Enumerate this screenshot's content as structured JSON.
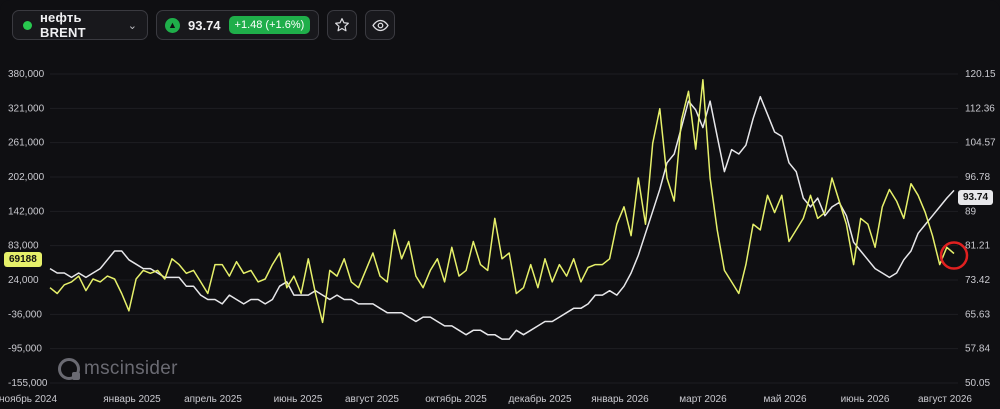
{
  "toolbar": {
    "ticker": "нефть BRENT",
    "status_color": "#28c84f",
    "price": "93.74",
    "change": "+1.48 (+1.6%)",
    "direction_icon": "triangle-up-icon",
    "favorite_icon": "star-icon",
    "watch_icon": "eye-icon",
    "dropdown_icon": "chevron-down-icon"
  },
  "watermark": {
    "text": "mscinsider",
    "logo_icon": "msc-logo-icon"
  },
  "chart_data": {
    "type": "line",
    "x_labels": [
      "ноябрь 2024",
      "январь 2025",
      "апрель 2025",
      "июнь 2025",
      "август 2025",
      "октябрь 2025",
      "декабрь 2025",
      "январь 2026",
      "март 2026",
      "май 2026",
      "июнь 2026",
      "август 2026"
    ],
    "left_axis": {
      "ticks": [
        "380,000",
        "321,000",
        "261,000",
        "202,000",
        "142,000",
        "83,000",
        "24,000",
        "-36,000",
        "-95,000",
        "-155,000"
      ],
      "range": [
        -155000,
        380000
      ],
      "current_value": "69188",
      "current_color": "#e6f06a"
    },
    "right_axis": {
      "ticks": [
        "120.15",
        "112.36",
        "104.57",
        "96.78",
        "89",
        "81.21",
        "73.42",
        "65.63",
        "57.84",
        "50.05"
      ],
      "range": [
        50.05,
        120.15
      ],
      "current_value": "93.74",
      "current_color": "#e7e7ea"
    },
    "series": [
      {
        "axis": "left",
        "color": "#e6f06a",
        "values": [
          10000,
          0,
          15000,
          20000,
          30000,
          5000,
          25000,
          20000,
          30000,
          25000,
          0,
          -30000,
          25000,
          40000,
          35000,
          40000,
          25000,
          60000,
          50000,
          35000,
          40000,
          20000,
          0,
          50000,
          50000,
          30000,
          55000,
          35000,
          40000,
          20000,
          25000,
          50000,
          70000,
          10000,
          30000,
          0,
          60000,
          0,
          -50000,
          40000,
          30000,
          60000,
          20000,
          10000,
          40000,
          70000,
          30000,
          20000,
          110000,
          60000,
          90000,
          30000,
          10000,
          40000,
          60000,
          20000,
          80000,
          30000,
          40000,
          90000,
          50000,
          40000,
          130000,
          60000,
          70000,
          0,
          10000,
          50000,
          10000,
          60000,
          20000,
          50000,
          30000,
          60000,
          20000,
          45000,
          50000,
          50000,
          60000,
          120000,
          150000,
          100000,
          200000,
          120000,
          260000,
          320000,
          200000,
          160000,
          300000,
          350000,
          250000,
          370000,
          200000,
          110000,
          40000,
          20000,
          0,
          50000,
          120000,
          110000,
          170000,
          140000,
          170000,
          90000,
          110000,
          130000,
          170000,
          130000,
          140000,
          200000,
          160000,
          120000,
          50000,
          130000,
          120000,
          80000,
          150000,
          180000,
          160000,
          130000,
          190000,
          170000,
          140000,
          100000,
          50000,
          80000,
          69188
        ]
      },
      {
        "axis": "right",
        "color": "#e7e7ea",
        "values": [
          76,
          75,
          75,
          74,
          75,
          74,
          75,
          76,
          78,
          80,
          80,
          78,
          77,
          76,
          76,
          75,
          74,
          74,
          74,
          72,
          72,
          70,
          69,
          69,
          68,
          70,
          69,
          68,
          69,
          69,
          68,
          69,
          72,
          73,
          70,
          70,
          70,
          71,
          70,
          69,
          70,
          69,
          69,
          68,
          68,
          68,
          67,
          66,
          66,
          66,
          65,
          64,
          65,
          65,
          64,
          63,
          63,
          62,
          61,
          62,
          62,
          61,
          61,
          60,
          60,
          62,
          61,
          62,
          63,
          64,
          64,
          65,
          66,
          67,
          67,
          68,
          70,
          70,
          71,
          70,
          72,
          75,
          79,
          84,
          89,
          94,
          100,
          102,
          108,
          114,
          112,
          108,
          114,
          106,
          98,
          103,
          102,
          104,
          110,
          115,
          111,
          107,
          106,
          100,
          98,
          92,
          90,
          92,
          88,
          90,
          91,
          88,
          82,
          80,
          78,
          76,
          75,
          74,
          75,
          78,
          80,
          84,
          86,
          88,
          90,
          92,
          93.74
        ]
      }
    ],
    "annotation": {
      "type": "circle",
      "color": "#e02020",
      "at_series": 0,
      "at_index": 126
    }
  }
}
